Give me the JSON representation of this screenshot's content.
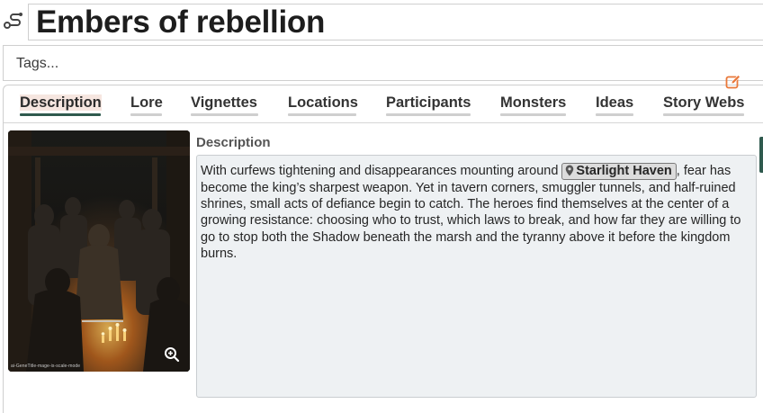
{
  "page": {
    "title": "Embers of rebellion",
    "title_icon": "quest-path-icon"
  },
  "tags": {
    "placeholder": "Tags..."
  },
  "tabs": [
    {
      "label": "Description",
      "active": true
    },
    {
      "label": "Lore",
      "active": false
    },
    {
      "label": "Vignettes",
      "active": false
    },
    {
      "label": "Locations",
      "active": false
    },
    {
      "label": "Participants",
      "active": false
    },
    {
      "label": "Monsters",
      "active": false
    },
    {
      "label": "Ideas",
      "active": false
    },
    {
      "label": "Story Webs",
      "active": false
    }
  ],
  "image": {
    "alt_icon": "zoom-in-icon",
    "caption": "ai-GeneTitle-mage-is-scale-mode"
  },
  "description": {
    "heading": "Description",
    "text_before": "With curfews tightening and disappearances mounting around ",
    "location_link": "Starlight Haven",
    "text_after": ", fear has become the king’s sharpest weapon. Yet in tavern corners, smuggler tunnels, and half-ruined shrines, small acts of defiance begin to catch. The heroes find themselves at the center of a growing resistance: choosing who to trust, which laws to break, and how far they are willing to go to stop both the Shadow beneath the marsh and the tyranny above it before the kingdom burns.",
    "edit_icon": "edit-icon"
  },
  "colors": {
    "accent": "#2f5a4e",
    "active_tab_bg": "#f6e6e0",
    "edit": "#e9783a",
    "desc_bg": "#eef1f3"
  }
}
